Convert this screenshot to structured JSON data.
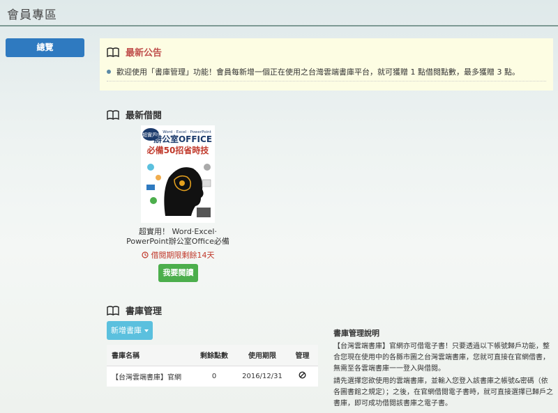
{
  "page": {
    "title": "會員專區"
  },
  "sidebar": {
    "overview_label": "總覽"
  },
  "announcement": {
    "title": "最新公告",
    "items": [
      "歡迎使用「書庫管理」功能！會員每新增一個正在使用之台灣雲端書庫平台，就可獲贈 1 點借閱點數，最多獲贈 3 點。"
    ]
  },
  "recent": {
    "title": "最新借閱",
    "book": {
      "cover_badge": "超實用!",
      "cover_top": "Word · Excel · PowerPoint",
      "cover_title1": "辦公室OFFICE",
      "cover_title2": "必備50招省時技",
      "title": "超實用！ Word‧Excel‧PowerPoint辦公室Office必備",
      "deadline": "借閱期限剩餘14天",
      "read_label": "我要閱讀"
    }
  },
  "library": {
    "title": "書庫管理",
    "add_label": "新增書庫",
    "columns": [
      "書庫名稱",
      "剩餘點數",
      "使用期限",
      "管理"
    ],
    "rows": [
      {
        "name": "【台灣雲端書庫】官網",
        "points": "0",
        "expiry": "2016/12/31"
      }
    ]
  },
  "help": {
    "title": "書庫管理說明",
    "p1": "【台灣雲端書庫】官網亦可借電子書！只要透過以下帳號歸戶功能，整合您現在使用中的各縣市圖之台灣雲端書庫，您就可直接在官網借書，無需至各雲端書庫一一登入與借閱。",
    "p2": "請先選擇您欲使用的雲端書庫，並輸入您登入該書庫之帳號&密碼（依各圖書館之規定）；之後，在官網借閱電子書時，就可直接選擇已歸戶之書庫，即可成功借閱該書庫之電子書。"
  },
  "colors": {
    "primary": "#2f7ac0",
    "success": "#4cae4c",
    "info": "#5bc0de",
    "alert": "#c0504d",
    "notice_bg": "#fdfde3"
  }
}
